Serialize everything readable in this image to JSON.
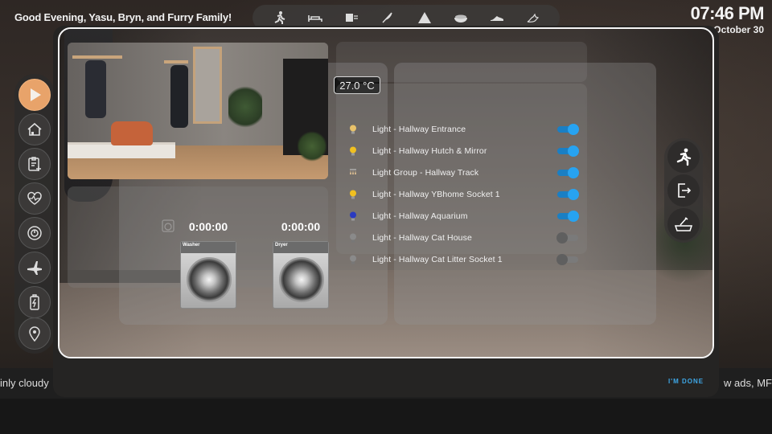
{
  "status_bar": {
    "greeting": "Good Evening, Yasu, Bryn, and Furry Family!",
    "time": "07:46 PM",
    "date": ", October 30"
  },
  "top_nav": {
    "icons": [
      "running-person-icon",
      "bed-icon",
      "heater-icon",
      "feather-icon",
      "tent-icon",
      "bowl-icon",
      "shoe-icon",
      "cat-icon"
    ]
  },
  "sidebar": {
    "items": [
      {
        "icon": "play-icon",
        "active": true
      },
      {
        "icon": "house-icon",
        "active": false
      },
      {
        "icon": "clipboard-add-icon",
        "active": false
      },
      {
        "icon": "heartbeat-icon",
        "active": false
      },
      {
        "icon": "meter-icon",
        "active": false
      },
      {
        "icon": "airplane-icon",
        "active": false
      },
      {
        "icon": "battery-charging-icon",
        "active": false
      },
      {
        "icon": "location-pin-icon",
        "active": false
      }
    ]
  },
  "right_bar": {
    "items": [
      "running-person-icon",
      "exit-door-icon",
      "litter-box-icon"
    ]
  },
  "camera": {
    "temperature": "27.0 °C"
  },
  "appliances": {
    "washer": {
      "timer": "0:00:00",
      "label": "Washer"
    },
    "dryer": {
      "timer": "0:00:00",
      "label": "Dryer"
    }
  },
  "lights": [
    {
      "name": "Light - Hallway Entrance",
      "state": "on",
      "icon": "bulb-icon",
      "color": "#e8c26a"
    },
    {
      "name": "Light - Hallway Hutch & Mirror",
      "state": "on",
      "icon": "bulb-icon",
      "color": "#f0c020"
    },
    {
      "name": "Light Group - Hallway Track",
      "state": "on",
      "icon": "track-lights-icon",
      "color": "#e9c896"
    },
    {
      "name": "Light - Hallway YBhome Socket 1",
      "state": "on",
      "icon": "bulb-icon",
      "color": "#f0c020"
    },
    {
      "name": "Light - Hallway Aquarium",
      "state": "on",
      "icon": "bulb-icon",
      "color": "#2a3ac0"
    },
    {
      "name": "Light - Hallway Cat House",
      "state": "off",
      "icon": "bulb-icon",
      "color": "#8a8a8a"
    },
    {
      "name": "Light - Hallway Cat Litter Socket 1",
      "state": "off",
      "icon": "bulb-icon",
      "color": "#8a8a8a"
    }
  ],
  "ticker": {
    "left_text": "inly cloudy",
    "right_text": "w ads, MF"
  },
  "dialog": {
    "done_label": "I'M DONE"
  },
  "colors": {
    "toggle_on": "#27a3f1",
    "accent_done": "#3ea8e8",
    "sidebar_active": "#e8a36a"
  }
}
